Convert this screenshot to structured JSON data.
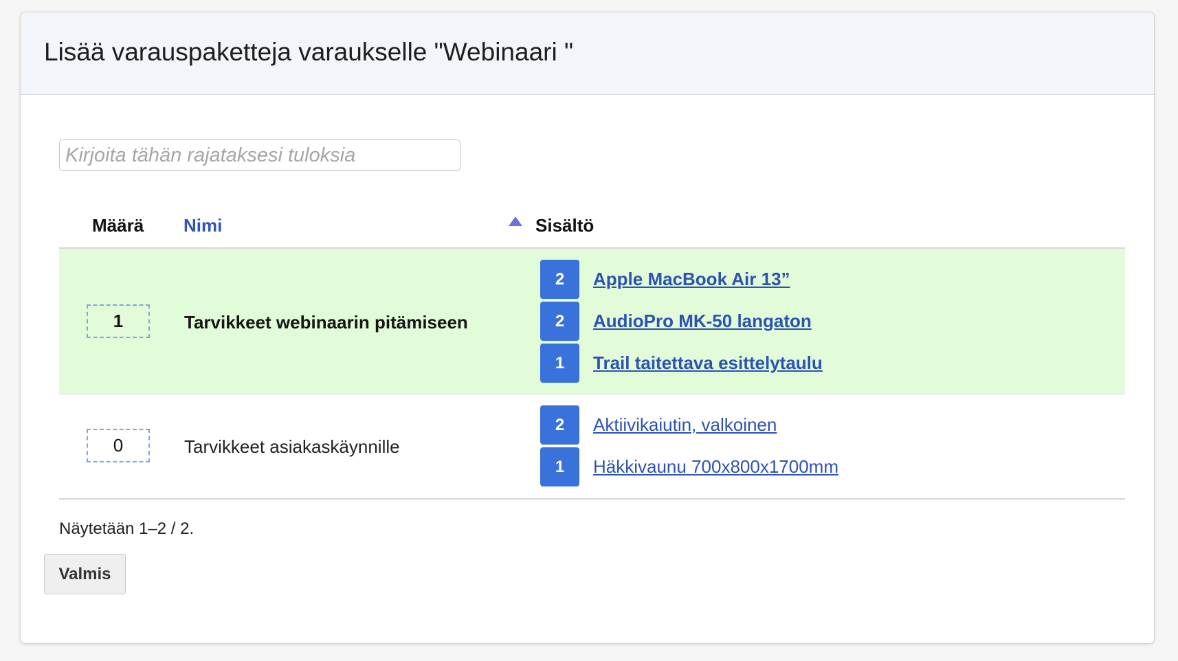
{
  "dialog": {
    "title": "Lisää varauspaketteja varaukselle \"Webinaari \""
  },
  "search": {
    "placeholder": "Kirjoita tähän rajataksesi tuloksia",
    "value": ""
  },
  "table": {
    "columns": {
      "quantity": "Määrä",
      "name": "Nimi",
      "contents": "Sisältö"
    },
    "sort": {
      "column": "name",
      "direction": "ascending",
      "icon": "triangle-up-icon"
    },
    "rows": [
      {
        "quantity": "1",
        "name": "Tarvikkeet webinaarin pitämiseen",
        "highlighted": true,
        "items": [
          {
            "count": "2",
            "name": "Apple MacBook Air 13”"
          },
          {
            "count": "2",
            "name": "AudioPro MK-50 langaton"
          },
          {
            "count": "1",
            "name": "Trail taitettava esittelytaulu"
          }
        ]
      },
      {
        "quantity": "0",
        "name": "Tarvikkeet asiakaskäynnille",
        "highlighted": false,
        "items": [
          {
            "count": "2",
            "name": "Aktiivikaiutin, valkoinen"
          },
          {
            "count": "1",
            "name": "Häkkivaunu 700x800x1700mm"
          }
        ]
      }
    ]
  },
  "pager": {
    "text": "Näytetään 1–2 / 2."
  },
  "buttons": {
    "done": "Valmis"
  },
  "colors": {
    "header_bg": "#f2f5f9",
    "highlight_row": "#e2fbd9",
    "badge": "#3a72dc",
    "link": "#2c52b3",
    "sort_icon": "#6b71d8"
  }
}
